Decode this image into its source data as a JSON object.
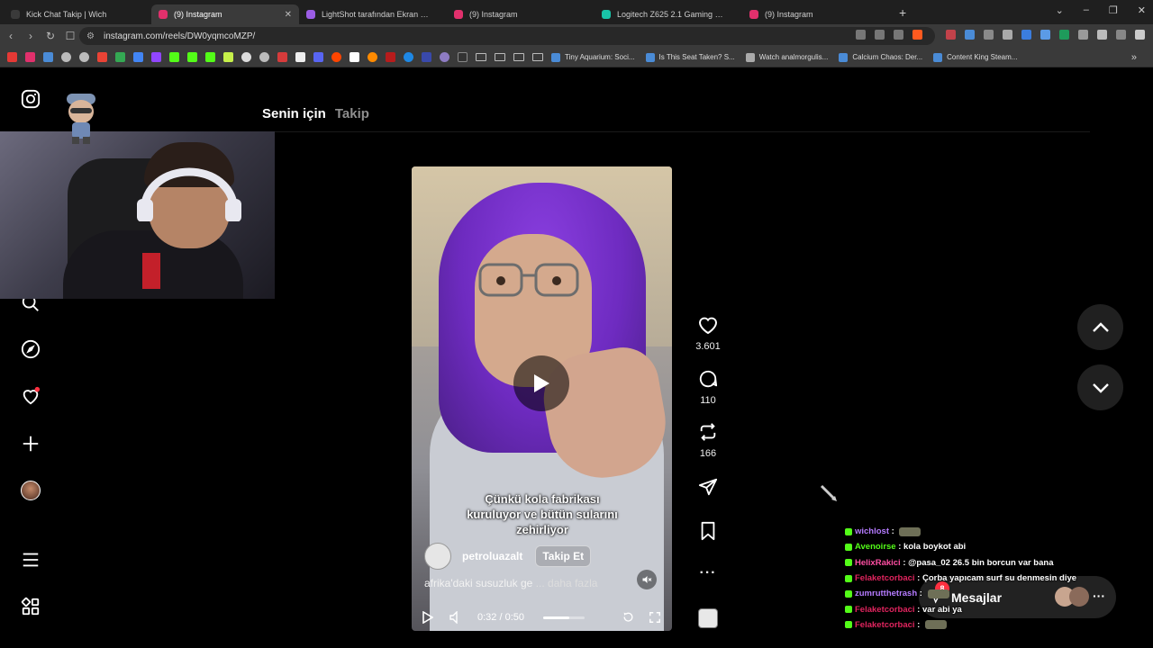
{
  "browser": {
    "tabs": [
      {
        "label": "Kick Chat Takip | Wich",
        "color": "#3a3a3a",
        "active": false
      },
      {
        "label": "(9) Instagram",
        "color": "#e1306c",
        "active": true
      },
      {
        "label": "LightShot tarafından Ekran Görüntüsü",
        "color": "#9b5de5",
        "active": false
      },
      {
        "label": "(9) Instagram",
        "color": "#e1306c",
        "active": false
      },
      {
        "label": "Logitech Z625 2.1 Gaming Speaker Sy",
        "color": "#19c3a7",
        "active": false
      },
      {
        "label": "(9) Instagram",
        "color": "#e1306c",
        "active": false
      }
    ],
    "url": "instagram.com/reels/DW0yqmcoMZP/",
    "bookmarks": [
      "Tiny Aquarium: Soci...",
      "Is This Seat Taken? S...",
      "Watch analmorgulis...",
      "Calcium Chaos: Der...",
      "Content King Steam..."
    ]
  },
  "instagram": {
    "feed_tabs": {
      "for_you": "Senin için",
      "following": "Takip"
    },
    "reel": {
      "caption": "Çünkü kola fabrikası kuruluyor ve bütün sularını zehirliyor",
      "author": "petroluazalt",
      "follow_label": "Takip Et",
      "description": "afrika'daki susuzluk ge",
      "more_label": "... daha fazla",
      "time": "0:32 / 0:50",
      "progress": 0.64
    },
    "actions": {
      "likes": "3.601",
      "comments": "110",
      "reposts": "166"
    },
    "messages_label": "Mesajlar",
    "messages_badge": "8"
  },
  "chat": [
    {
      "user": "wichlost",
      "color": "#b57bff",
      "text": "",
      "emote": true
    },
    {
      "user": "Avenoirse",
      "color": "#53fc18",
      "text": "kola boykot abi",
      "emote": false
    },
    {
      "user": "HelixRakici",
      "color": "#ff4fa3",
      "text": "@pasa_02 26.5 bin borcun var bana",
      "emote": false
    },
    {
      "user": "Felaketcorbaci",
      "color": "#e0245e",
      "text": "Çorba yapıcam surf su denmesin diye",
      "emote": false
    },
    {
      "user": "zumrutthetrash",
      "color": "#b57bff",
      "text": "",
      "emote": true
    },
    {
      "user": "Felaketcorbaci",
      "color": "#e0245e",
      "text": "var abi ya",
      "emote": false
    },
    {
      "user": "Felaketcorbaci",
      "color": "#e0245e",
      "text": "",
      "emote": true
    }
  ]
}
